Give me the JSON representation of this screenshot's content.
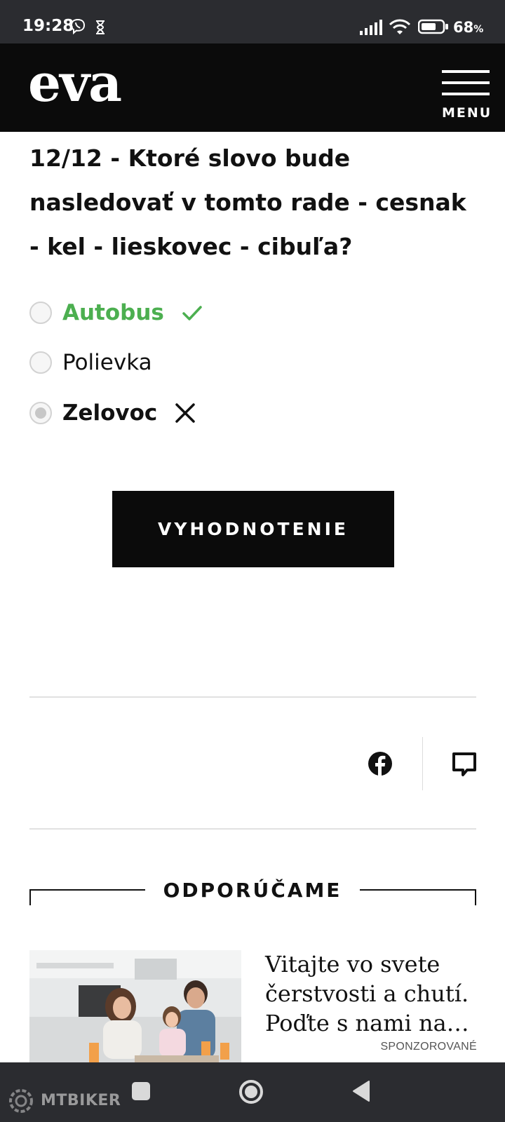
{
  "status_bar": {
    "time": "19:28",
    "battery_percent": "68",
    "battery_unit": "%",
    "icons": [
      "viber-icon",
      "hourglass-icon",
      "signal-icon",
      "wifi-icon",
      "battery-icon"
    ]
  },
  "header": {
    "logo": "eva",
    "menu_label": "MENU"
  },
  "quiz": {
    "question": "12/12 - Ktoré slovo bude nasledovať v tomto rade - cesnak - kel - lieskovec - cibuľa?",
    "answers": [
      {
        "label": "Autobus",
        "state": "correct"
      },
      {
        "label": "Polievka",
        "state": "none"
      },
      {
        "label": "Zelovoc",
        "state": "wrong",
        "selected": true
      }
    ],
    "evaluate_label": "VYHODNOTENIE",
    "colors": {
      "correct": "#4caf50",
      "text": "#111111"
    }
  },
  "share": {
    "icons": [
      "facebook-icon",
      "comment-icon"
    ]
  },
  "recommend": {
    "title": "ODPORÚČAME",
    "items": [
      {
        "text": "Vitajte vo svete čerstvosti a chutí. Poďte s nami na…",
        "badge": "SPONZOROVANÉ"
      }
    ]
  },
  "watermark": "MTBIKER",
  "colors": {
    "header_bg": "#0b0b0b",
    "system_bar_bg": "#2b2c30"
  }
}
